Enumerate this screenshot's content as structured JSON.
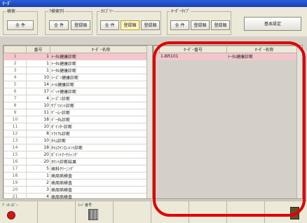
{
  "window": {
    "title": "ｵｰﾀﾞ"
  },
  "toolbar": {
    "groups": [
      {
        "label": "検索",
        "buttons": [
          "全 件"
        ]
      },
      {
        "label": "ｱ検索列",
        "buttons": [
          "全 件",
          "登録順"
        ]
      },
      {
        "label": "ｶﾃｺﾞﾘｰ",
        "buttons": [
          "全 件",
          "登録順",
          "登録順"
        ]
      },
      {
        "label": "ｵｰﾀﾞｰﾀｲﾌﾟ",
        "buttons": [
          "全 件",
          "登録順",
          "登録順"
        ]
      }
    ],
    "settings_button": "基本設定"
  },
  "left_table": {
    "headers": [
      "",
      "番号",
      "ｵｰﾀﾞｰ名称"
    ],
    "rows": [
      {
        "num": "1",
        "code": "1",
        "name": "ﾄｰﾀﾙ健康診断",
        "selected": true
      },
      {
        "num": "2",
        "code": "1",
        "name": "ﾄｰﾀﾙ健康診断",
        "selected": false
      },
      {
        "num": "3",
        "code": "1",
        "name": "ﾄｰﾀﾙ健康診断",
        "selected": false
      },
      {
        "num": "4",
        "code": "10",
        "name": "ｼｰｽﾞﾝ健康診断",
        "selected": false
      },
      {
        "num": "5",
        "code": "14",
        "name": "ﾒｰﾙ健康診断",
        "selected": false
      },
      {
        "num": "6",
        "code": "17",
        "name": "ﾍﾟｯﾄ健康診断",
        "selected": false
      },
      {
        "num": "7",
        "code": "4",
        "name": "ｼｰｽﾞﾝ診断",
        "selected": false
      },
      {
        "num": "8",
        "code": "10",
        "name": "ｻﾌﾟﾘﾒﾝﾄ診断",
        "selected": false
      },
      {
        "num": "9",
        "code": "11",
        "name": "ｹﾞｰﾑｰ診断",
        "selected": false
      },
      {
        "num": "10",
        "code": "18",
        "name": "ﾃﾞｰﾀﾙ診断",
        "selected": false
      },
      {
        "num": "11",
        "code": "10",
        "name": "ﾎﾟｲﾝﾀｰ診断",
        "selected": false
      },
      {
        "num": "12",
        "code": "8",
        "name": "ﾄﾗｲｱﾙ診断",
        "selected": false
      },
      {
        "num": "13",
        "code": "10",
        "name": "ﾀｲﾑ診断",
        "selected": false
      },
      {
        "num": "14",
        "code": "18",
        "name": "ﾀｲﾑﾗｲﾝｴﾚﾒﾝﾄ診断",
        "selected": false
      },
      {
        "num": "15",
        "code": "20",
        "name": "ﾎﾟｲﾝﾄﾏｰｹﾃｨﾝｸﾞ",
        "selected": false
      },
      {
        "num": "16",
        "code": "20",
        "name": "ｶｳﾝﾄ診断結果",
        "selected": false
      },
      {
        "num": "17",
        "code": "5",
        "name": "歯科ｸﾘｰﾆﾝｸﾞ",
        "selected": false
      },
      {
        "num": "18",
        "code": "1",
        "name": "歯周病検査",
        "selected": false
      },
      {
        "num": "19",
        "code": "2",
        "name": "歯周病検査",
        "selected": false
      },
      {
        "num": "20",
        "code": "3",
        "name": "歯周病検査",
        "selected": false
      },
      {
        "num": "21",
        "code": "4",
        "name": "歯周病検査",
        "selected": false
      },
      {
        "num": "22",
        "code": "7",
        "name": "ｺｲﾝ検査　定期健康診断",
        "selected": false
      }
    ]
  },
  "right_table": {
    "headers": [
      "ｵｰﾀﾞｰ番号",
      "ｵｰﾀﾞｰ名称"
    ],
    "rows": [
      {
        "code": "1-BR101",
        "name": "ﾄｰﾀﾙ健康診断",
        "selected": true
      }
    ]
  },
  "bottom": {
    "cells": [
      {
        "label": "ﾃﾞｰﾀｰｺﾋﾟｰ",
        "icon": "red-circle-icon"
      },
      {
        "label": "",
        "icon": ""
      },
      {
        "label": "ｺｰﾄﾞ番号",
        "icon": "barcode-icon"
      },
      {
        "label": "",
        "icon": ""
      },
      {
        "label": "",
        "icon": ""
      },
      {
        "label": "",
        "icon": ""
      },
      {
        "label": "",
        "icon": ""
      },
      {
        "label": "",
        "icon": "exit-door-icon"
      }
    ]
  },
  "colors": {
    "callout": "#e00000",
    "selected_row": "#f6c5cc",
    "title_bar": "#2a5fd7"
  }
}
